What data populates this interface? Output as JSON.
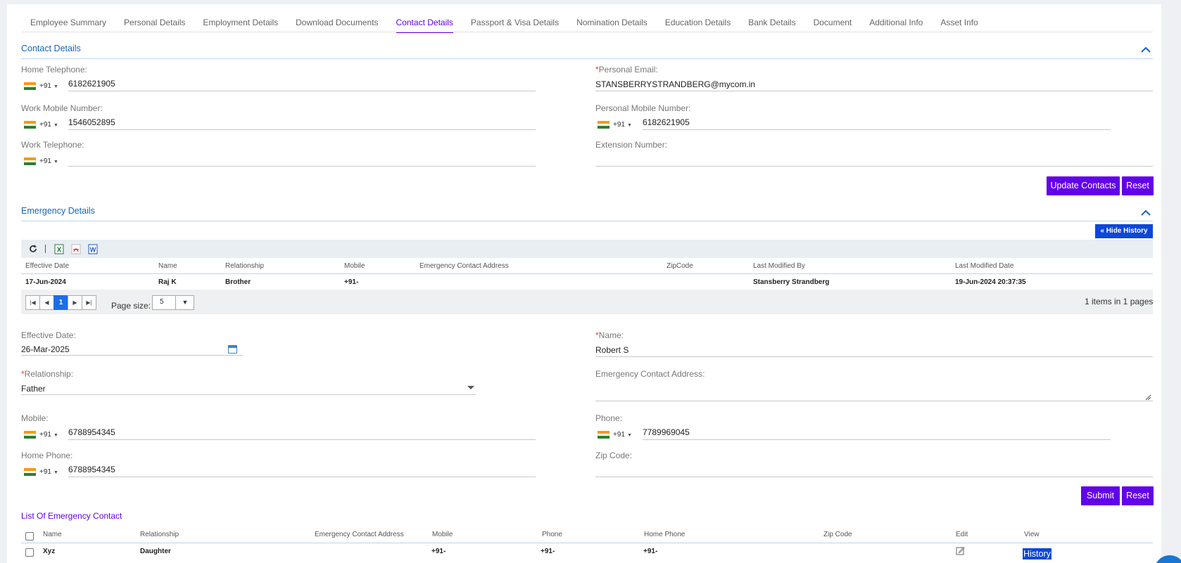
{
  "tabs": [
    {
      "label": "Employee Summary",
      "active": false
    },
    {
      "label": "Personal Details",
      "active": false
    },
    {
      "label": "Employment Details",
      "active": false
    },
    {
      "label": "Download Documents",
      "active": false
    },
    {
      "label": "Contact Details",
      "active": true
    },
    {
      "label": "Passport & Visa Details",
      "active": false
    },
    {
      "label": "Nomination Details",
      "active": false
    },
    {
      "label": "Education Details",
      "active": false
    },
    {
      "label": "Bank Details",
      "active": false
    },
    {
      "label": "Document",
      "active": false
    },
    {
      "label": "Additional Info",
      "active": false
    },
    {
      "label": "Asset Info",
      "active": false
    }
  ],
  "contact": {
    "title": "Contact Details",
    "home_telephone": {
      "label": "Home Telephone:",
      "code": "+91",
      "value": "6182621905"
    },
    "work_mobile": {
      "label": "Work Mobile Number:",
      "code": "+91",
      "value": "1546052895"
    },
    "work_telephone": {
      "label": "Work Telephone:",
      "code": "+91",
      "value": ""
    },
    "personal_email": {
      "required": "*",
      "label": "Personal Email:",
      "value": "STANSBERRYSTRANDBERG@mycom.in"
    },
    "personal_mobile": {
      "label": "Personal Mobile Number:",
      "code": "+91",
      "value": "6182621905"
    },
    "extension": {
      "label": "Extension Number:",
      "value": ""
    },
    "update_button": "Update Contacts",
    "reset_button": "Reset"
  },
  "emergency": {
    "title": "Emergency Details",
    "hide_history_button": "« Hide History",
    "grid": {
      "columns": [
        "Effective Date",
        "Name",
        "Relationship",
        "Mobile",
        "Emergency Contact Address",
        "ZipCode",
        "Last Modified By",
        "Last Modified Date"
      ],
      "rows": [
        [
          "17-Jun-2024",
          "Raj K",
          "Brother",
          "+91-",
          "",
          "",
          "Stansberry Strandberg",
          "19-Jun-2024 20:37:35"
        ]
      ],
      "current_page": "1",
      "page_size_label": "Page size:",
      "page_size": "5",
      "summary": "1 items in 1 pages"
    },
    "form": {
      "effective_date": {
        "label": "Effective Date:",
        "value": "26-Mar-2025"
      },
      "name": {
        "required": "*",
        "label": "Name:",
        "value": "Robert S"
      },
      "relationship": {
        "required": "*",
        "label": "Relationship:",
        "value": "Father"
      },
      "address": {
        "label": "Emergency Contact Address:",
        "value": ""
      },
      "mobile": {
        "label": "Mobile:",
        "code": "+91",
        "value": "6788954345"
      },
      "phone": {
        "label": "Phone:",
        "code": "+91",
        "value": "7789969045"
      },
      "home_phone": {
        "label": "Home Phone:",
        "code": "+91",
        "value": "6788954345"
      },
      "zip": {
        "label": "Zip Code:",
        "value": ""
      },
      "submit_button": "Submit",
      "reset_button": "Reset"
    }
  },
  "list": {
    "title": "List Of Emergency Contact",
    "columns": [
      "Name",
      "Relationship",
      "Emergency Contact Address",
      "Mobile",
      "Phone",
      "Home Phone",
      "Zip Code",
      "Edit",
      "View"
    ],
    "rows": [
      {
        "name": "Xyz",
        "relationship": "Daughter",
        "address": "",
        "mobile": "+91-",
        "phone": "+91-",
        "home_phone": "+91-",
        "zip": "",
        "view": "History"
      }
    ]
  },
  "colors": {
    "accent": "#6200ea",
    "link": "#1565c0",
    "action_blue": "#0d47d9"
  },
  "icons": [
    "refresh-icon",
    "excel-icon",
    "pdf-icon",
    "word-icon",
    "calendar-icon",
    "edit-icon",
    "chevron-up-icon",
    "india-flag-icon"
  ]
}
